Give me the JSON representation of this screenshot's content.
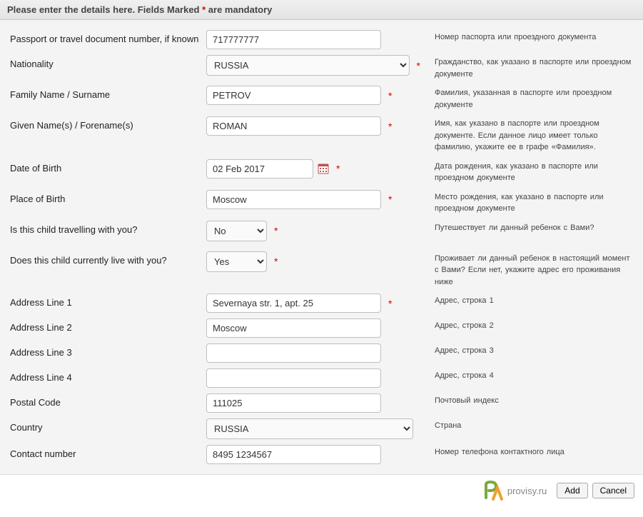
{
  "header": {
    "text_before": "Please enter the details here. Fields Marked ",
    "star": "*",
    "text_after": " are mandatory"
  },
  "fields": {
    "passport": {
      "label": "Passport or travel document number, if known",
      "value": "717777777",
      "hint": "Номер паспорта или проездного документа"
    },
    "nationality": {
      "label": "Nationality",
      "value": "RUSSIA",
      "hint": "Гражданство, как указано в паспорте или проездном документе"
    },
    "surname": {
      "label": "Family Name / Surname",
      "value": "PETROV",
      "hint": "Фамилия, указанная в паспорте или проездном документе"
    },
    "given": {
      "label": "Given Name(s) / Forename(s)",
      "value": "ROMAN",
      "hint": "Имя, как указано в паспорте или проездном документе. Если данное лицо имеет только фамилию, укажите ее в графе «Фамилия»."
    },
    "dob": {
      "label": "Date of Birth",
      "value": "02 Feb 2017",
      "hint": "Дата рождения, как указано в паспорте или проездном документе"
    },
    "pob": {
      "label": "Place of Birth",
      "value": "Moscow",
      "hint": "Место рождения, как указано в паспорте или проездном документе"
    },
    "travelling": {
      "label": "Is this child travelling with you?",
      "value": "No",
      "hint": "Путешествует ли данный ребенок с Вами?"
    },
    "living": {
      "label": "Does this child currently live with you?",
      "value": "Yes",
      "hint": "Проживает ли данный ребенок в настоящий момент с Вами? Если нет, укажите адрес его проживания ниже"
    },
    "addr1": {
      "label": "Address Line 1",
      "value": "Severnaya str. 1, apt. 25",
      "hint": "Адрес, строка 1"
    },
    "addr2": {
      "label": "Address Line 2",
      "value": "Moscow",
      "hint": "Адрес, строка 2"
    },
    "addr3": {
      "label": "Address Line 3",
      "value": "",
      "hint": "Адрес, строка 3"
    },
    "addr4": {
      "label": "Address Line 4",
      "value": "",
      "hint": "Адрес, строка 4"
    },
    "postal": {
      "label": "Postal Code",
      "value": "111025",
      "hint": "Почтовый индекс"
    },
    "country": {
      "label": "Country",
      "value": "RUSSIA",
      "hint": "Страна"
    },
    "contact": {
      "label": "Contact number",
      "value": "8495 1234567",
      "hint": "Номер телефона контактного лица"
    }
  },
  "footer": {
    "logo_text": "provisy.ru",
    "add": "Add",
    "cancel": "Cancel"
  }
}
